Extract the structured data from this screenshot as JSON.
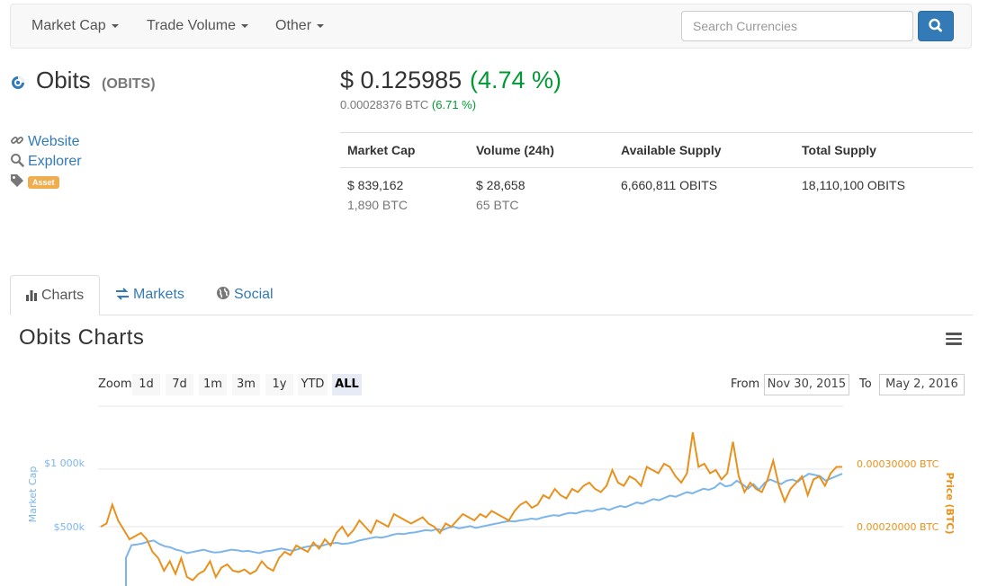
{
  "navbar": {
    "items": [
      "Market Cap",
      "Trade Volume",
      "Other"
    ],
    "search_placeholder": "Search Currencies"
  },
  "coin": {
    "name": "Obits",
    "symbol": "(OBITS)",
    "price_usd": "$ 0.125985",
    "change_usd": "(4.74 %)",
    "price_btc": "0.00028376 BTC",
    "change_btc": "(6.71 %)"
  },
  "links": {
    "website": "Website",
    "explorer": "Explorer",
    "tag": "Asset"
  },
  "stats": {
    "headers": [
      "Market Cap",
      "Volume (24h)",
      "Available Supply",
      "Total Supply"
    ],
    "market_cap_usd": "$ 839,162",
    "market_cap_btc": "1,890 BTC",
    "volume_usd": "$ 28,658",
    "volume_btc": "65 BTC",
    "available_supply": "6,660,811 OBITS",
    "total_supply": "18,110,100 OBITS"
  },
  "tabs": [
    "Charts",
    "Markets",
    "Social"
  ],
  "chart_section": {
    "title": "Obits Charts",
    "zoom_label": "Zoom",
    "zoom_options": [
      "1d",
      "7d",
      "1m",
      "3m",
      "1y",
      "YTD",
      "ALL"
    ],
    "zoom_selected": "ALL",
    "from_label": "From",
    "from_date": "Nov 30, 2015",
    "to_label": "To",
    "to_date": "May 2, 2016"
  },
  "colors": {
    "accent": "#337ab7",
    "positive": "#009933",
    "market_cap_line": "#7cb5ec",
    "price_line": "#e8911c"
  },
  "chart_data": {
    "type": "line",
    "x_range": [
      "Nov 30, 2015",
      "May 2, 2016"
    ],
    "left_axis": {
      "label": "Market Cap",
      "ticks": [
        "$1 000k",
        "$500k"
      ],
      "tick_values": [
        1000000,
        500000
      ]
    },
    "right_axis": {
      "label": "Price (BTC)",
      "ticks": [
        "0.00030000 BTC",
        "0.00020000 BTC"
      ],
      "tick_values": [
        0.0003,
        0.0002
      ]
    },
    "series": [
      {
        "name": "Market Cap",
        "axis": "left",
        "values": [
          230000,
          340000,
          345000,
          355000,
          370000,
          380000,
          350000,
          330000,
          320000,
          300000,
          290000,
          270000,
          280000,
          290000,
          300000,
          285000,
          275000,
          280000,
          290000,
          300000,
          295000,
          285000,
          290000,
          280000,
          270000,
          285000,
          290000,
          300000,
          310000,
          300000,
          290000,
          305000,
          320000,
          330000,
          340000,
          330000,
          345000,
          355000,
          360000,
          350000,
          355000,
          365000,
          380000,
          390000,
          400000,
          410000,
          405000,
          415000,
          430000,
          440000,
          435000,
          445000,
          450000,
          460000,
          470000,
          465000,
          480000,
          470000,
          490000,
          500000,
          485000,
          495000,
          505000,
          490000,
          500000,
          510000,
          520000,
          530000,
          540000,
          550000,
          545000,
          555000,
          560000,
          570000,
          565000,
          580000,
          590000,
          600000,
          595000,
          610000,
          620000,
          615000,
          630000,
          640000,
          635000,
          650000,
          660000,
          645000,
          665000,
          680000,
          670000,
          690000,
          710000,
          700000,
          720000,
          740000,
          730000,
          750000,
          770000,
          760000,
          780000,
          800000,
          790000,
          810000,
          830000,
          820000,
          840000,
          880000,
          850000,
          860000,
          900000,
          870000,
          830000,
          870000,
          820000,
          880000,
          910000,
          890000,
          870000,
          900000,
          910000,
          890000,
          930000,
          960000,
          950000,
          940000,
          900000,
          920000,
          940000,
          960000
        ]
      },
      {
        "name": "Price (BTC)",
        "axis": "right",
        "values": [
          0.0002,
          0.000205,
          0.000235,
          0.00021,
          0.000195,
          0.00018,
          0.000185,
          0.00019,
          0.00018,
          0.00016,
          0.00015,
          0.00013,
          0.000145,
          0.000125,
          0.00015,
          0.00012,
          0.000115,
          0.000125,
          0.00013,
          0.000145,
          0.00012,
          0.000135,
          0.00014,
          0.00013,
          0.000128,
          0.000132,
          0.000125,
          0.00013,
          0.000145,
          0.000135,
          0.00013,
          0.00015,
          0.00016,
          0.000155,
          0.00017,
          0.000165,
          0.00016,
          0.000175,
          0.000165,
          0.00018,
          0.00017,
          0.00019,
          0.0002,
          0.000185,
          0.000195,
          0.00021,
          0.0002,
          0.00019,
          0.00021,
          0.000205,
          0.0002,
          0.00022,
          0.000215,
          0.00021,
          0.000205,
          0.00021,
          0.000215,
          0.000205,
          0.0002,
          0.00019,
          0.000205,
          0.0002,
          0.00021,
          0.00022,
          0.000215,
          0.00021,
          0.00022,
          0.000215,
          0.000225,
          0.00022,
          0.000215,
          0.00021,
          0.000225,
          0.000235,
          0.00024,
          0.00023,
          0.000235,
          0.00025,
          0.000245,
          0.00026,
          0.00025,
          0.000245,
          0.00026,
          0.000255,
          0.000265,
          0.00027,
          0.00026,
          0.000255,
          0.000265,
          0.00029,
          0.00027,
          0.000265,
          0.00028,
          0.000275,
          0.000265,
          0.000295,
          0.00029,
          0.000285,
          0.0003,
          0.000295,
          0.00028,
          0.00027,
          0.000285,
          0.00035,
          0.000295,
          0.0003,
          0.000285,
          0.00029,
          0.000275,
          0.000285,
          0.000335,
          0.00028,
          0.000255,
          0.00027,
          0.00026,
          0.000255,
          0.000275,
          0.000305,
          0.000265,
          0.00024,
          0.00026,
          0.00027,
          0.00028,
          0.00025,
          0.000275,
          0.00028,
          0.000265,
          0.000285,
          0.000295,
          0.000295
        ]
      }
    ]
  }
}
